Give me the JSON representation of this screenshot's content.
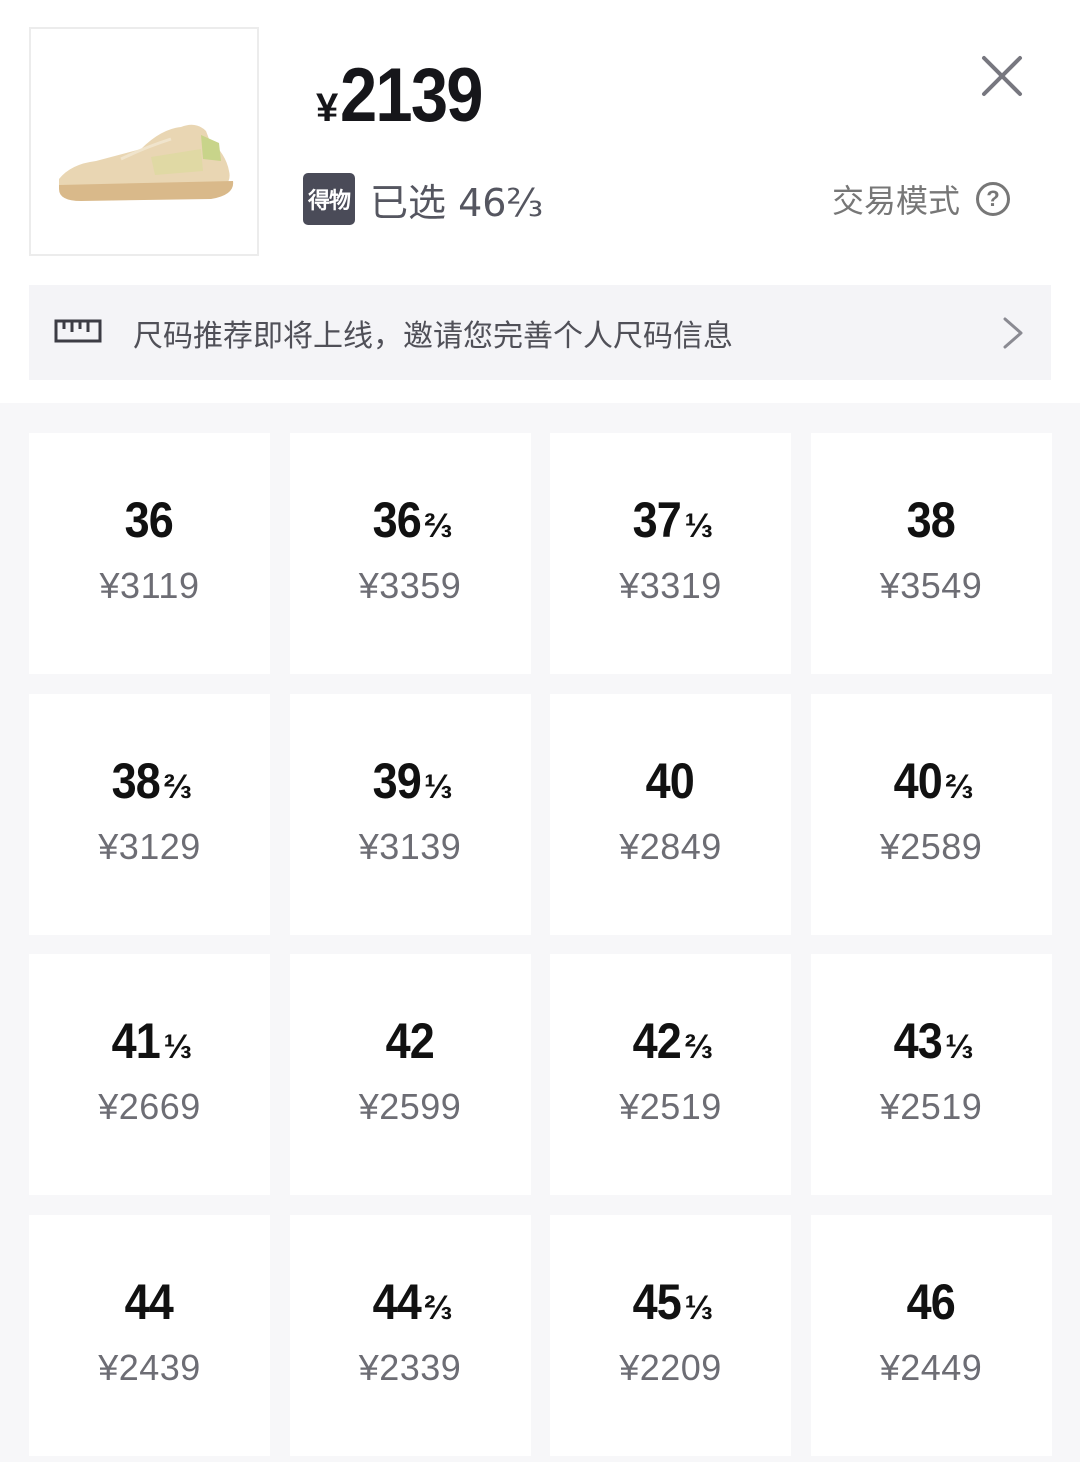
{
  "header": {
    "currency": "¥",
    "price": "2139",
    "badge": "得物",
    "selected": "已选 46⅔",
    "trade_mode": "交易模式",
    "trade_mode_help": "?"
  },
  "banner": {
    "text": "尺码推荐即将上线，邀请您完善个人尺码信息"
  },
  "sizes": [
    {
      "size": "36",
      "frac": "",
      "price": "¥3119"
    },
    {
      "size": "36",
      "frac": "⅔",
      "price": "¥3359"
    },
    {
      "size": "37",
      "frac": "⅓",
      "price": "¥3319"
    },
    {
      "size": "38",
      "frac": "",
      "price": "¥3549"
    },
    {
      "size": "38",
      "frac": "⅔",
      "price": "¥3129"
    },
    {
      "size": "39",
      "frac": "⅓",
      "price": "¥3139"
    },
    {
      "size": "40",
      "frac": "",
      "price": "¥2849"
    },
    {
      "size": "40",
      "frac": "⅔",
      "price": "¥2589"
    },
    {
      "size": "41",
      "frac": "⅓",
      "price": "¥2669"
    },
    {
      "size": "42",
      "frac": "",
      "price": "¥2599"
    },
    {
      "size": "42",
      "frac": "⅔",
      "price": "¥2519"
    },
    {
      "size": "43",
      "frac": "⅓",
      "price": "¥2519"
    },
    {
      "size": "44",
      "frac": "",
      "price": "¥2439"
    },
    {
      "size": "44",
      "frac": "⅔",
      "price": "¥2339"
    },
    {
      "size": "45",
      "frac": "⅓",
      "price": "¥2209"
    },
    {
      "size": "46",
      "frac": "",
      "price": "¥2449"
    }
  ],
  "icons": {
    "close": "close-icon",
    "ruler": "ruler-icon",
    "chevron": "chevron-right-icon",
    "help": "question-circle-icon"
  },
  "colors": {
    "badge_bg": "#4a4b58",
    "banner_bg": "#f4f4f7",
    "grid_bg": "#f7f7f9"
  }
}
